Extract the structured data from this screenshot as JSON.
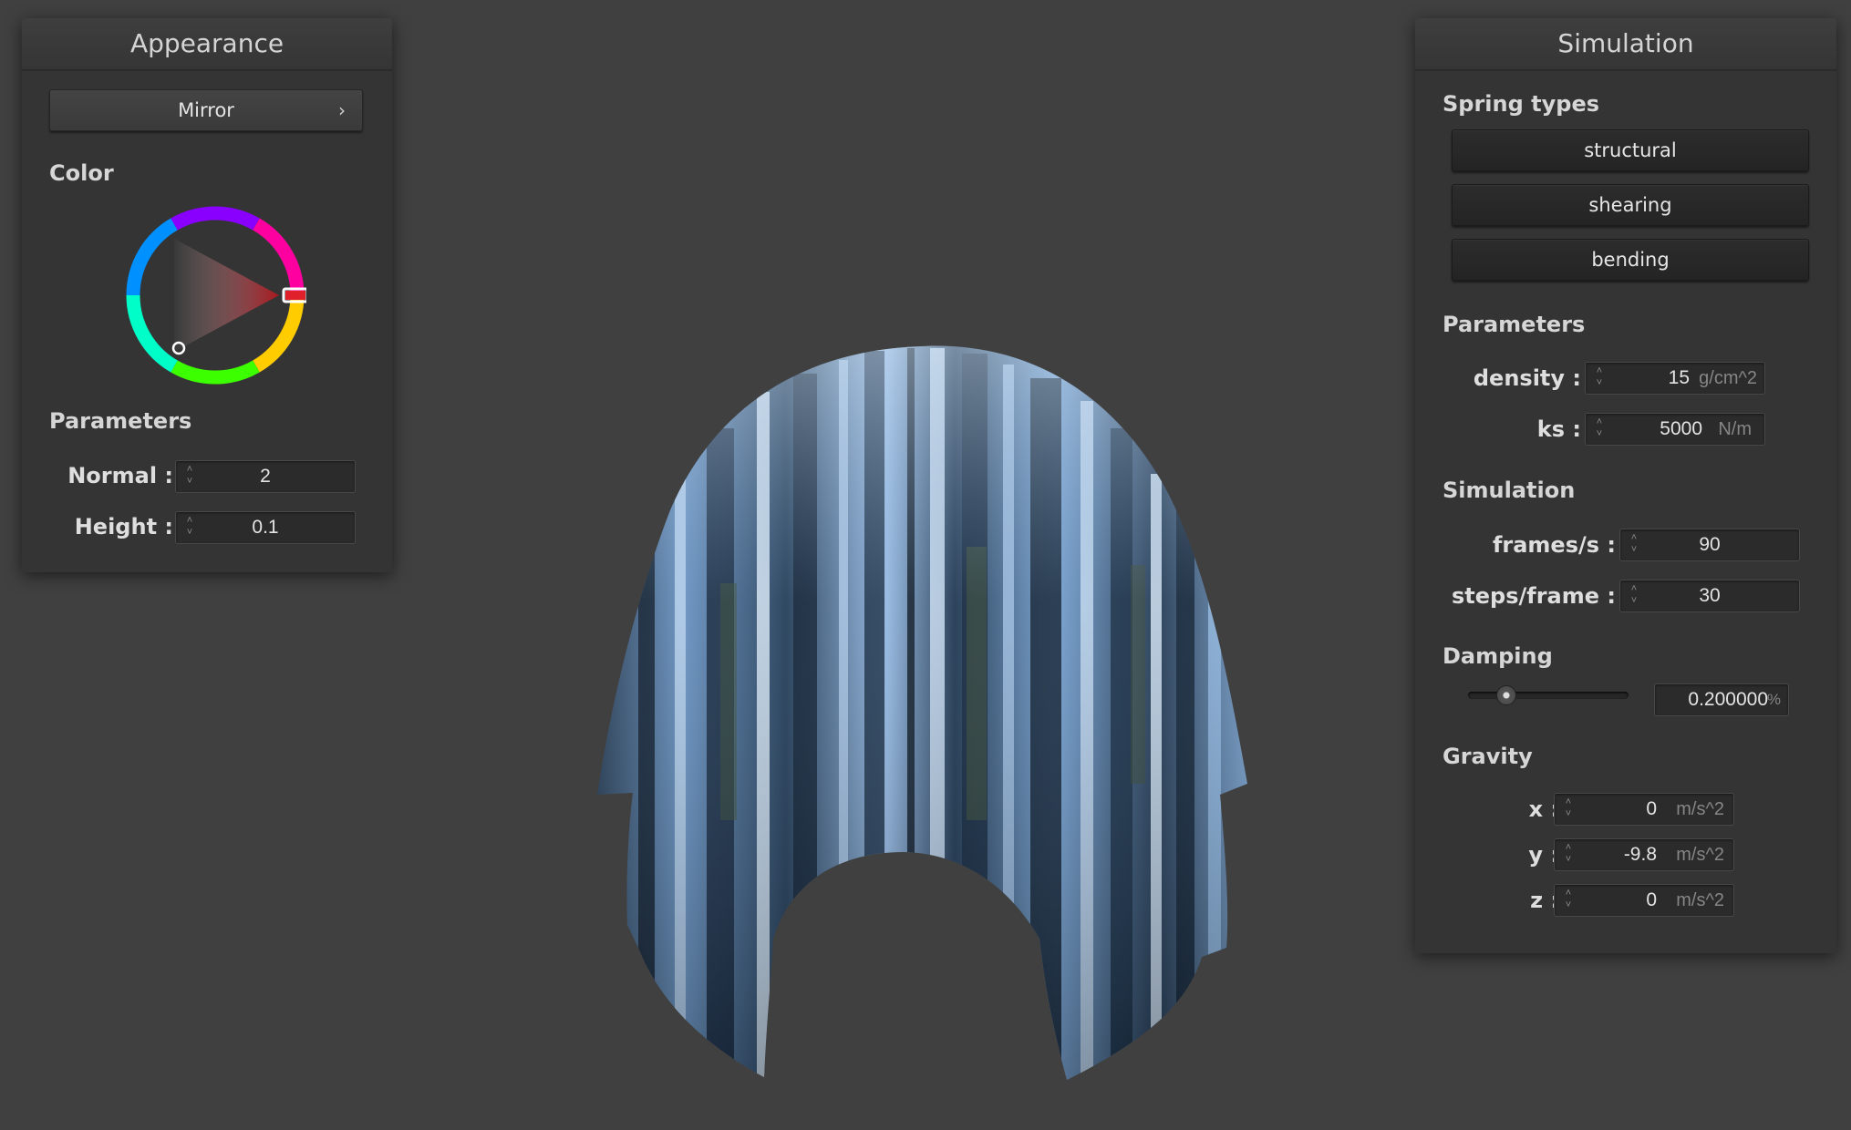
{
  "appearance": {
    "title": "Appearance",
    "shader_select": "Mirror",
    "color_label": "Color",
    "parameters_label": "Parameters",
    "normal_label": "Normal :",
    "normal_value": "2",
    "height_label": "Height :",
    "height_value": "0.1",
    "selected_color": "#e0202a"
  },
  "simulation": {
    "title": "Simulation",
    "spring_types_label": "Spring types",
    "springs": [
      "structural",
      "shearing",
      "bending"
    ],
    "parameters_label": "Parameters",
    "density_label": "density :",
    "density_value": "15",
    "density_unit": "g/cm^2",
    "ks_label": "ks :",
    "ks_value": "5000",
    "ks_unit": "N/m",
    "simulation_label": "Simulation",
    "fps_label": "frames/s :",
    "fps_value": "90",
    "steps_label": "steps/frame :",
    "steps_value": "30",
    "damping_label": "Damping",
    "damping_value": "0.200000",
    "damping_unit": "%",
    "damping_slider_fraction": 0.2,
    "gravity_label": "Gravity",
    "gx_label": "x :",
    "gx_value": "0",
    "gy_label": "y :",
    "gy_value": "-9.8",
    "gz_label": "z :",
    "gz_value": "0",
    "gravity_unit": "m/s^2"
  }
}
